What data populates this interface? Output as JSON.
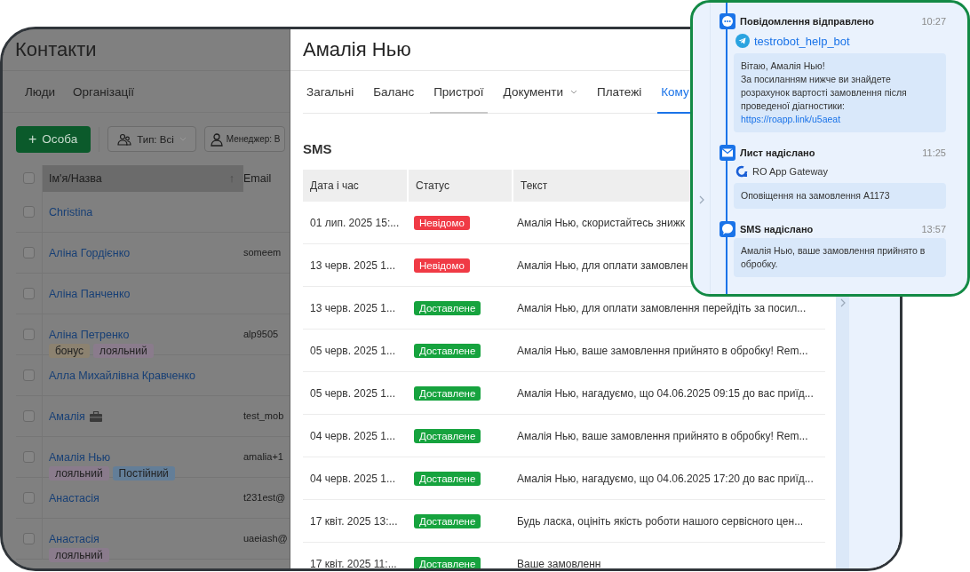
{
  "contacts": {
    "title": "Контакти",
    "tabs": [
      {
        "label": "Люди"
      },
      {
        "label": "Організації"
      }
    ],
    "add_button": {
      "icon": "+",
      "label": "Особа"
    },
    "filters": [
      {
        "kind": "type",
        "label": "Тип: Всі",
        "dropdown": true
      },
      {
        "kind": "manager",
        "label": "Менеджер: В",
        "dropdown": false
      }
    ],
    "table": {
      "header_checked": false,
      "columns": [
        {
          "label": "Ім'я/Назва",
          "sorted": true,
          "sort_icon": "↑"
        },
        {
          "label": "Email",
          "sorted": false
        }
      ],
      "rows": [
        {
          "name": "Christina",
          "email": "",
          "kind": "person",
          "checked": false,
          "tags": []
        },
        {
          "name": "Аліна Гордієнко",
          "email": "someem",
          "kind": "person",
          "checked": false,
          "tags": []
        },
        {
          "name": "Аліна Панченко",
          "email": "",
          "kind": "person",
          "checked": false,
          "tags": []
        },
        {
          "name": "Аліна Петренко",
          "email": "alp9505",
          "kind": "person",
          "checked": false,
          "tags": [
            {
              "label": "бонус",
              "color": "#8c8270"
            },
            {
              "label": "лояльний",
              "color": "#8a7b8c"
            }
          ]
        },
        {
          "name": "Алла Михайлівна Кравченко",
          "email": "",
          "kind": "person",
          "checked": false,
          "tags": []
        },
        {
          "name": "Амалія",
          "email": "test_mob",
          "kind": "organization",
          "checked": false,
          "tags": []
        },
        {
          "name": "Амалія Нью",
          "email": "amalia+1",
          "kind": "person",
          "checked": false,
          "tags": [
            {
              "label": "лояльний",
              "color": "#8a7b8c"
            },
            {
              "label": "Постійний",
              "color": "#637e98"
            }
          ]
        },
        {
          "name": "Анастасія",
          "email": "t231est@",
          "kind": "person",
          "checked": false,
          "tags": []
        },
        {
          "name": "Анастасія",
          "email": "uaeiash@",
          "kind": "person",
          "checked": false,
          "tags": [
            {
              "label": "лояльний",
              "color": "#8a7b8c"
            }
          ]
        }
      ]
    }
  },
  "drawer": {
    "title": "Амалія Нью",
    "tabs": [
      {
        "label": "Загальні",
        "selected": false,
        "hovered": false,
        "dropdown": false
      },
      {
        "label": "Баланс",
        "selected": false,
        "hovered": false,
        "dropdown": false
      },
      {
        "label": "Пристрої",
        "selected": false,
        "hovered": true,
        "dropdown": false
      },
      {
        "label": "Документи",
        "selected": false,
        "hovered": false,
        "dropdown": true
      },
      {
        "label": "Платежі",
        "selected": false,
        "hovered": false,
        "dropdown": false
      },
      {
        "label": "Кому",
        "selected": true,
        "hovered": false,
        "dropdown": false
      }
    ],
    "section_title": "SMS",
    "table": {
      "columns": [
        "Дата і час",
        "Статус",
        "Текст"
      ],
      "rows": [
        {
          "date": "01 лип. 2025 15:...",
          "status": {
            "label": "Невідомо",
            "color": "#f03a45"
          },
          "text": "Амалія Нью, скористайтесь знижк"
        },
        {
          "date": "13 черв. 2025 1...",
          "status": {
            "label": "Невідомо",
            "color": "#f03a45"
          },
          "text": "Амалія Нью, для оплати замовлен"
        },
        {
          "date": "13 черв. 2025 1...",
          "status": {
            "label": "Доставлене",
            "color": "#16a33e"
          },
          "text": "Амалія Нью, для оплати замовлення перейдіть за посил..."
        },
        {
          "date": "05 черв. 2025 1...",
          "status": {
            "label": "Доставлене",
            "color": "#16a33e"
          },
          "text": "Амалія Нью, ваше замовлення прийнято в обробку! Rem..."
        },
        {
          "date": "05 черв. 2025 1...",
          "status": {
            "label": "Доставлене",
            "color": "#16a33e"
          },
          "text": "Амалія Нью, нагадуємо, що 04.06.2025 09:15 до вас приїд..."
        },
        {
          "date": "04 черв. 2025 1...",
          "status": {
            "label": "Доставлене",
            "color": "#16a33e"
          },
          "text": "Амалія Нью, ваше замовлення прийнято в обробку! Rem..."
        },
        {
          "date": "04 черв. 2025 1...",
          "status": {
            "label": "Доставлене",
            "color": "#16a33e"
          },
          "text": "Амалія Нью, нагадуємо, що 04.06.2025 17:20 до вас приїд..."
        },
        {
          "date": "17 квіт. 2025 13:...",
          "status": {
            "label": "Доставлене",
            "color": "#16a33e"
          },
          "text": "Будь ласка, оцініть якість роботи нашого сервісного цен..."
        },
        {
          "date": "17 квіт. 2025 11:...",
          "status": {
            "label": "Доставлене",
            "color": "#16a33e"
          },
          "text": "Ваше замовленн"
        }
      ]
    }
  },
  "timeline": {
    "events": [
      {
        "kind": "message",
        "title": "Повідомлення відправлено",
        "time": "10:27",
        "channel": {
          "kind": "telegram",
          "name": "testrobot_help_bot"
        },
        "message": {
          "lines": [
            "Вітаю, Амалія Нью!",
            "За посиланням нижче ви знайдете розрахунок вартості замовлення після проведеної діагностики:"
          ],
          "link": "https://roapp.link/u5aeat"
        }
      },
      {
        "kind": "email",
        "title": "Лист надіслано",
        "time": "11:25",
        "channel": {
          "kind": "gateway",
          "name": "RO App Gateway"
        },
        "message": {
          "lines": [
            "Оповіщення на замовлення A1173"
          ]
        }
      },
      {
        "kind": "sms",
        "title": "SMS надіслано",
        "time": "13:57",
        "message": {
          "lines": [
            "Амалія Нью, ваше замовлення прийнято в обробку."
          ]
        }
      }
    ]
  }
}
